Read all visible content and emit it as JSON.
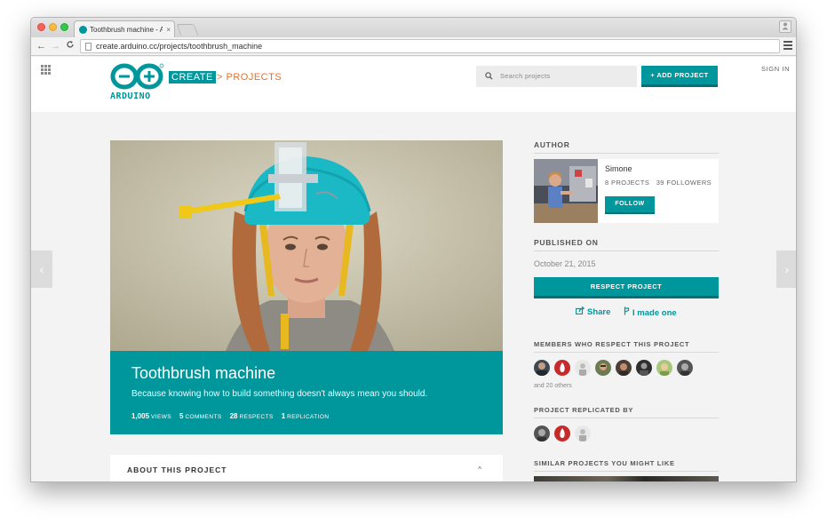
{
  "browser": {
    "tab_title": "Toothbrush machine - Ardu",
    "tab_close": "×",
    "url": "create.arduino.cc/projects/toothbrush_machine",
    "back": "←",
    "forward": "→",
    "reload": "C"
  },
  "header": {
    "logo_text": "ARDUINO",
    "create_label": "CREATE",
    "projects_label": "> PROJECTS",
    "search_placeholder": "Search projects",
    "add_project_label": "+ ADD PROJECT",
    "sign_in_label": "SIGN IN"
  },
  "nav": {
    "prev_arrow": "‹",
    "next_arrow": "›"
  },
  "project": {
    "title": "Toothbrush machine",
    "subtitle": "Because knowing how to build something doesn't always mean you should.",
    "stats": [
      {
        "value": "1,005",
        "label": "VIEWS"
      },
      {
        "value": "5",
        "label": "COMMENTS"
      },
      {
        "value": "28",
        "label": "RESPECTS"
      },
      {
        "value": "1",
        "label": "REPLICATION"
      }
    ],
    "about_title": "ABOUT THIS PROJECT",
    "about_caret": "^"
  },
  "sidebar": {
    "author_heading": "AUTHOR",
    "author_name": "Simone",
    "author_projects": "8 PROJECTS",
    "author_followers": "39 FOLLOWERS",
    "follow_label": "FOLLOW",
    "published_heading": "PUBLISHED ON",
    "published_date": "October 21, 2015",
    "respect_label": "RESPECT PROJECT",
    "share_label": "Share",
    "made_one_label": "I made one",
    "respect_members_heading": "MEMBERS WHO RESPECT THIS PROJECT",
    "others_text": "and 20 others",
    "replicated_heading": "PROJECT REPLICATED BY",
    "similar_heading": "SIMILAR PROJECTS YOU MIGHT LIKE"
  },
  "colors": {
    "accent": "#00979c",
    "accent_dark": "#006e72",
    "projects_orange": "#e47128"
  }
}
